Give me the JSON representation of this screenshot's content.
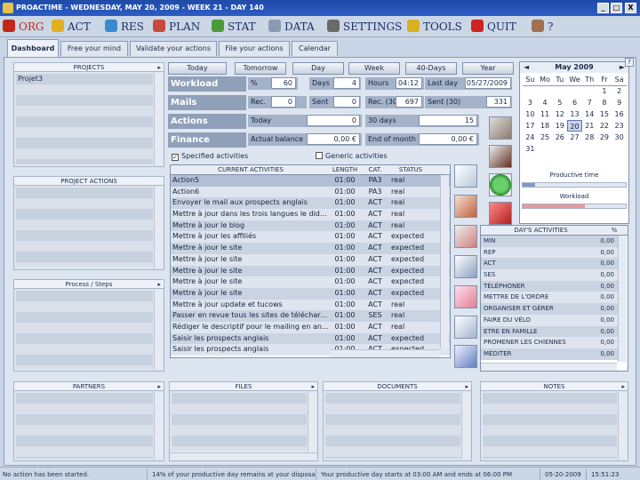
{
  "window": {
    "title": "PROACTIME - WEDNESDAY, MAY 20, 2009 - WEEK 21 - DAY 140",
    "controls": [
      "_",
      "□",
      "X"
    ]
  },
  "menu": [
    {
      "label": "ORG",
      "icon": "org-icon",
      "color": "#c0281a"
    },
    {
      "label": "ACT",
      "icon": "warning-icon",
      "color": "#e0b020"
    },
    {
      "label": "RES",
      "icon": "globe-icon",
      "color": "#3a8ad0"
    },
    {
      "label": "PLAN",
      "icon": "calendar-icon",
      "color": "#c84a3a"
    },
    {
      "label": "STAT",
      "icon": "chart-icon",
      "color": "#4a9a3a"
    },
    {
      "label": "DATA",
      "icon": "document-icon",
      "color": "#8a9ab0"
    },
    {
      "label": "SETTINGS",
      "icon": "gear-icon",
      "color": "#6a6a6a"
    },
    {
      "label": "TOOLS",
      "icon": "wand-icon",
      "color": "#d8b020"
    },
    {
      "label": "QUIT",
      "icon": "power-icon",
      "color": "#d02020"
    },
    {
      "label": "?",
      "icon": "help-icon",
      "color": "#a07050"
    }
  ],
  "tabs": [
    "Dashboard",
    "Free your mind",
    "Validate your actions",
    "File your actions",
    "Calendar"
  ],
  "panels": {
    "projects": "PROJECTS",
    "project_item": "Projet3",
    "project_actions": "PROJECT ACTIONS",
    "process": "Process / Steps",
    "partners": "PARTNERS",
    "files": "FILES",
    "documents": "DOCUMENTS",
    "notes": "NOTES"
  },
  "periods": [
    "Today",
    "Tomorrow",
    "Day",
    "Week",
    "40-Days",
    "Year"
  ],
  "stats": {
    "workload": {
      "label": "Workload",
      "pct_label": "%",
      "pct": "60",
      "days_label": "Days",
      "days": "4",
      "hours_label": "Hours",
      "hours": "04:12",
      "lastday_label": "Last day",
      "lastday": "05/27/2009"
    },
    "mails": {
      "label": "Mails",
      "rec_label": "Rec.",
      "rec": "0",
      "sent_label": "Sent",
      "sent": "0",
      "rec30_label": "Rec. (30)",
      "rec30": "697",
      "sent30_label": "Sent (30)",
      "sent30": "331"
    },
    "actions": {
      "label": "Actions",
      "today_label": "Today",
      "today": "0",
      "d30_label": "30 days",
      "d30": "15"
    },
    "finance": {
      "label": "Finance",
      "balance_label": "Actual balance",
      "balance": "0,00 €",
      "eom_label": "End of month",
      "eom": "0,00 €"
    }
  },
  "filters": {
    "specified": "Specified activities",
    "generic": "Generic activities"
  },
  "activities": {
    "headers": [
      "CURRENT ACTIVITIES",
      "LENGTH",
      "CAT.",
      "STATUS"
    ],
    "rows": [
      [
        "Action5",
        "01:00",
        "PA3",
        "real"
      ],
      [
        "Action6",
        "01:00",
        "PA3",
        "real"
      ],
      [
        "Envoyer le mail aux prospects anglais",
        "01:00",
        "ACT",
        "real"
      ],
      [
        "Mettre à jour dans les trois langues le didacticiel",
        "01:00",
        "ACT",
        "real"
      ],
      [
        "Mettre à jour le blog",
        "01:00",
        "ACT",
        "real"
      ],
      [
        "Mettre à jour les affiliés",
        "01:00",
        "ACT",
        "expected"
      ],
      [
        "Mettre à jour le site",
        "01:00",
        "ACT",
        "expected"
      ],
      [
        "Mettre à jour le site",
        "01:00",
        "ACT",
        "expected"
      ],
      [
        "Mettre à jour le site",
        "01:00",
        "ACT",
        "expected"
      ],
      [
        "Mettre à jour le site",
        "01:00",
        "ACT",
        "expected"
      ],
      [
        "Mettre à jour le site",
        "01:00",
        "ACT",
        "expected"
      ],
      [
        "Mettre à jour update et tucows",
        "01:00",
        "ACT",
        "real"
      ],
      [
        "Passer en revue tous les sites de téléchargeme...",
        "01:00",
        "SES",
        "real"
      ],
      [
        "Rédiger le descriptif pour le mailing en anglais ...",
        "01:00",
        "ACT",
        "real"
      ],
      [
        "Saisir les prospects anglais",
        "01:00",
        "ACT",
        "expected"
      ],
      [
        "Saisir les prospects anglais",
        "01:00",
        "ACT",
        "expected"
      ]
    ]
  },
  "calendar": {
    "month": "May 2009",
    "prev": "◄",
    "next": "►",
    "weekdays": [
      "Su",
      "Mo",
      "Tu",
      "We",
      "Th",
      "Fr",
      "Sa"
    ],
    "days": [
      "",
      "",
      "",
      "",
      "",
      "1",
      "2",
      "3",
      "4",
      "5",
      "6",
      "7",
      "8",
      "9",
      "10",
      "11",
      "12",
      "13",
      "14",
      "15",
      "16",
      "17",
      "18",
      "19",
      "20",
      "21",
      "22",
      "23",
      "24",
      "25",
      "26",
      "27",
      "28",
      "29",
      "30",
      "31",
      "",
      "",
      "",
      "",
      "",
      ""
    ],
    "today": "20",
    "productive_time": "Productive time",
    "workload": "Workload",
    "workload_fill_pct": 60
  },
  "day_activities": {
    "headers": [
      "DAY'S ACTIVITIES",
      "%"
    ],
    "rows": [
      [
        "MIN",
        "0,00"
      ],
      [
        "REP",
        "0,00"
      ],
      [
        "ACT",
        "0,00"
      ],
      [
        "SES",
        "0,00"
      ],
      [
        "TÉLÉPHONER",
        "0,00"
      ],
      [
        "METTRE DE L'ORDRE",
        "0,00"
      ],
      [
        "ORGANISER ET GÉRER",
        "0,00"
      ],
      [
        "FAIRE DU VÉLO",
        "0,00"
      ],
      [
        "ETRE EN FAMILLE",
        "0,00"
      ],
      [
        "PROMENER LES CHIENNES",
        "0,00"
      ],
      [
        "MÉDITER",
        "0,00"
      ]
    ]
  },
  "status": {
    "action": "No action has been started.",
    "remaining": "14% of your productive day remains at your disposal.",
    "day": "Your productive day starts at 03:00 AM and ends at 06:00 PM",
    "date": "05-20-2009",
    "time": "15:51:23"
  }
}
